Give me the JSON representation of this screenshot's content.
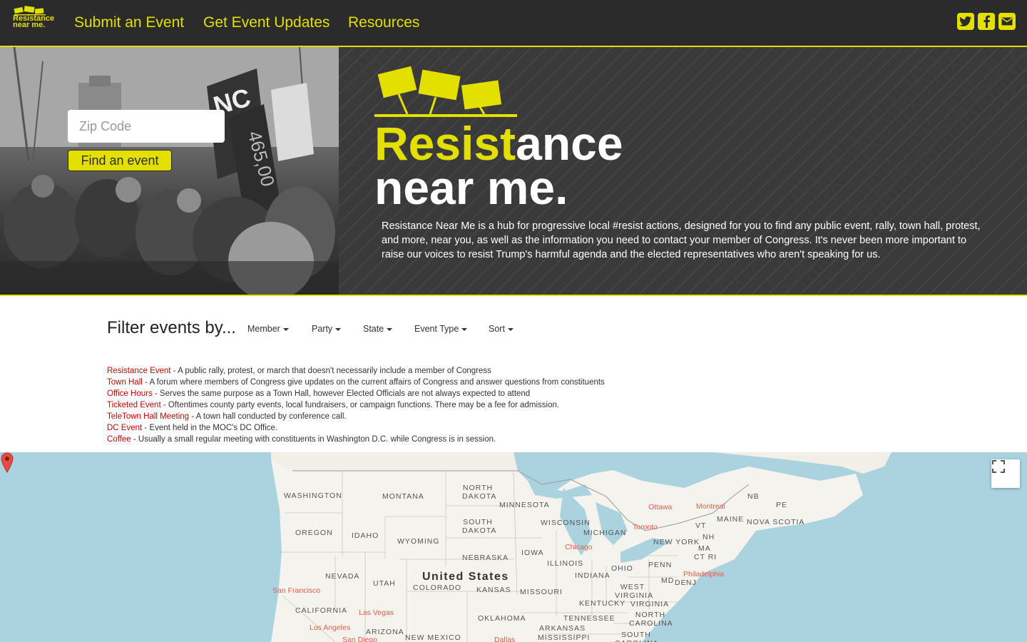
{
  "nav": {
    "brand_line1": "Resistance",
    "brand_line2": "near me.",
    "links": [
      "Submit an Event",
      "Get Event Updates",
      "Resources"
    ],
    "social_icons": [
      "twitter-icon",
      "facebook-icon",
      "envelope-icon"
    ],
    "accent_color": "#e3e000",
    "bg_color": "#2b2b2b"
  },
  "hero": {
    "zip_placeholder": "Zip Code",
    "find_button": "Find an event",
    "logo_yellow": "Resist",
    "logo_white": "ance",
    "logo_line2": "near me.",
    "description": "Resistance Near Me is a hub for progressive local #resist actions, designed for you to find any public event, rally, town hall, protest, and more, near you, as well as the information you need to contact your member of Congress. It's never been more important to raise our voices to resist Trump's harmful agenda and the elected representatives who aren't speaking for us."
  },
  "filter": {
    "title": "Filter events by...",
    "dropdowns": [
      "Member",
      "Party",
      "State",
      "Event Type",
      "Sort"
    ]
  },
  "legend": [
    {
      "term": "Resistance Event",
      "desc": " - A public rally, protest, or march that doesn't necessarily include a member of Congress"
    },
    {
      "term": "Town Hall",
      "desc": " - A forum where members of Congress give updates on the current affairs of Congress and answer questions from constituents"
    },
    {
      "term": "Office Hours",
      "desc": " - Serves the same purpose as a Town Hall, however Elected Officials are not always expected to attend"
    },
    {
      "term": "Ticketed Event",
      "desc": " - Oftentimes county party events, local fundraisers, or campaign functions. There may be a fee for admission."
    },
    {
      "term": "TeleTown Hall Meeting",
      "desc": " - A town hall conducted by conference call."
    },
    {
      "term": "DC Event",
      "desc": " - Event held in the MOC's DC Office."
    },
    {
      "term": "Coffee",
      "desc": " - Usually a small regular meeting with constituents in Washington D.C. while Congress is in session."
    }
  ],
  "map": {
    "country": "United States",
    "states": [
      "WASHINGTON",
      "MONTANA",
      "NORTH DAKOTA",
      "MINNESOTA",
      "OREGON",
      "IDAHO",
      "SOUTH DAKOTA",
      "WYOMING",
      "WISCONSIN",
      "MICHIGAN",
      "NEBRASKA",
      "IOWA",
      "ILLINOIS",
      "NEVADA",
      "UTAH",
      "COLORADO",
      "KANSAS",
      "MISSOURI",
      "INDIANA",
      "OHIO",
      "PENN",
      "WEST VIRGINIA",
      "VIRGINIA",
      "KENTUCKY",
      "TENNESSEE",
      "NORTH CAROLINA",
      "CALIFORNIA",
      "ARIZONA",
      "NEW MEXICO",
      "OKLAHOMA",
      "ARKANSAS",
      "MISSISSIPPI",
      "SOUTH CAROLINA",
      "NEW YORK",
      "MAINE",
      "VT",
      "NH",
      "MA",
      "CT RI",
      "MD",
      "DE",
      "NJ",
      "NB",
      "PE",
      "NOVA SCOTIA"
    ],
    "cities": [
      "Ottawa",
      "Montreal",
      "Toronto",
      "Chicago",
      "Philadelphia",
      "San Francisco",
      "Las Vegas",
      "Los Angeles",
      "San Diego",
      "Dallas"
    ],
    "marker_city": "Chicago",
    "water_color": "#aad3df",
    "land_color": "#f5f3ee"
  }
}
